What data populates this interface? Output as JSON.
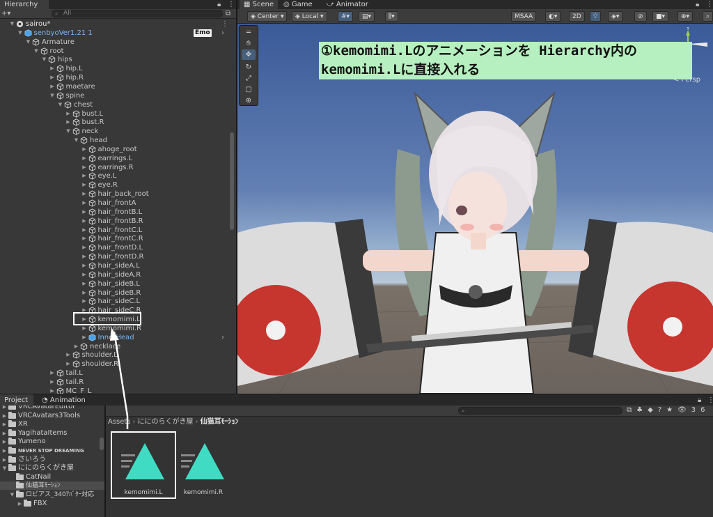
{
  "hierarchy": {
    "tab_label": "Hierarchy",
    "search_placeholder": "All",
    "items": [
      {
        "label": "sairou*",
        "kind": "scene"
      },
      {
        "label": "senbyoVer1.21 1",
        "kind": "prefab",
        "badge": "Emo"
      },
      {
        "label": "Armature"
      },
      {
        "label": "root"
      },
      {
        "label": "hips"
      },
      {
        "label": "hip.L"
      },
      {
        "label": "hip.R"
      },
      {
        "label": "maetare"
      },
      {
        "label": "spine"
      },
      {
        "label": "chest"
      },
      {
        "label": "bust.L"
      },
      {
        "label": "bust.R"
      },
      {
        "label": "neck"
      },
      {
        "label": "head"
      },
      {
        "label": "ahoge_root"
      },
      {
        "label": "earrings.L"
      },
      {
        "label": "earrings.R"
      },
      {
        "label": "eye.L"
      },
      {
        "label": "eye.R"
      },
      {
        "label": "hair_back_root"
      },
      {
        "label": "hair_frontA"
      },
      {
        "label": "hair_frontB.L"
      },
      {
        "label": "hair_frontB.R"
      },
      {
        "label": "hair_frontC.L"
      },
      {
        "label": "hair_frontC.R"
      },
      {
        "label": "hair_frontD.L"
      },
      {
        "label": "hair_frontD.R"
      },
      {
        "label": "hair_sideA.L"
      },
      {
        "label": "hair_sideA.R"
      },
      {
        "label": "hair_sideB.L"
      },
      {
        "label": "hair_sideB.R"
      },
      {
        "label": "hair_sideC.L"
      },
      {
        "label": "hair_sideC.R"
      },
      {
        "label": "kemomimi.L"
      },
      {
        "label": "kemomimi.R"
      },
      {
        "label": "InnerHead",
        "kind": "prefab"
      },
      {
        "label": "necklace"
      },
      {
        "label": "shoulder.L"
      },
      {
        "label": "shoulder.R"
      },
      {
        "label": "tail.L"
      },
      {
        "label": "tail.R"
      },
      {
        "label": "MC_F_L"
      }
    ]
  },
  "scene": {
    "tabs": [
      {
        "label": "Scene"
      },
      {
        "label": "Game"
      },
      {
        "label": "Animator"
      }
    ],
    "toolbar": {
      "pivot": "Center",
      "space": "Local",
      "msaa": "MSAA",
      "mode_2d": "2D"
    },
    "gizmo_axis": "Y",
    "persp_label": "< Persp",
    "annotation": {
      "line1": "①kemomimi.Lのアニメーションを Hierarchy内の",
      "line2": "  kemomimi.Lに直接入れる"
    }
  },
  "bottom_tabs": [
    {
      "label": "Project"
    },
    {
      "label": "Animation"
    }
  ],
  "project": {
    "tree": [
      {
        "label": "VRCAvatarEditor"
      },
      {
        "label": "VRCAvatars3Tools"
      },
      {
        "label": "XR"
      },
      {
        "label": "YagihataItems"
      },
      {
        "label": "Yumeno"
      },
      {
        "label": "NEVER STOP DREAMING"
      },
      {
        "label": "さいろう"
      },
      {
        "label": "ににのらくがき屋"
      },
      {
        "label": "CatNail"
      },
      {
        "label": "仙猫耳ﾓｰｼｮﾝ"
      },
      {
        "label": "ロビアス_340ｱﾊﾞﾀｰ対応"
      },
      {
        "label": "FBX"
      }
    ],
    "breadcrumb": [
      "Assets",
      "ににのらくがき屋",
      "仙猫耳ﾓｰｼｮﾝ"
    ],
    "assets": [
      {
        "label": "kemomimi.L"
      },
      {
        "label": "kemomimi.R"
      }
    ],
    "icon_count": "36"
  },
  "colors": {
    "panel_bg": "#383838",
    "selected_item": "#7bb7f5",
    "annotation_bg": "#b6f0c0",
    "anim_icon": "#3fdcc3",
    "highlight_box": "#ffffff"
  }
}
